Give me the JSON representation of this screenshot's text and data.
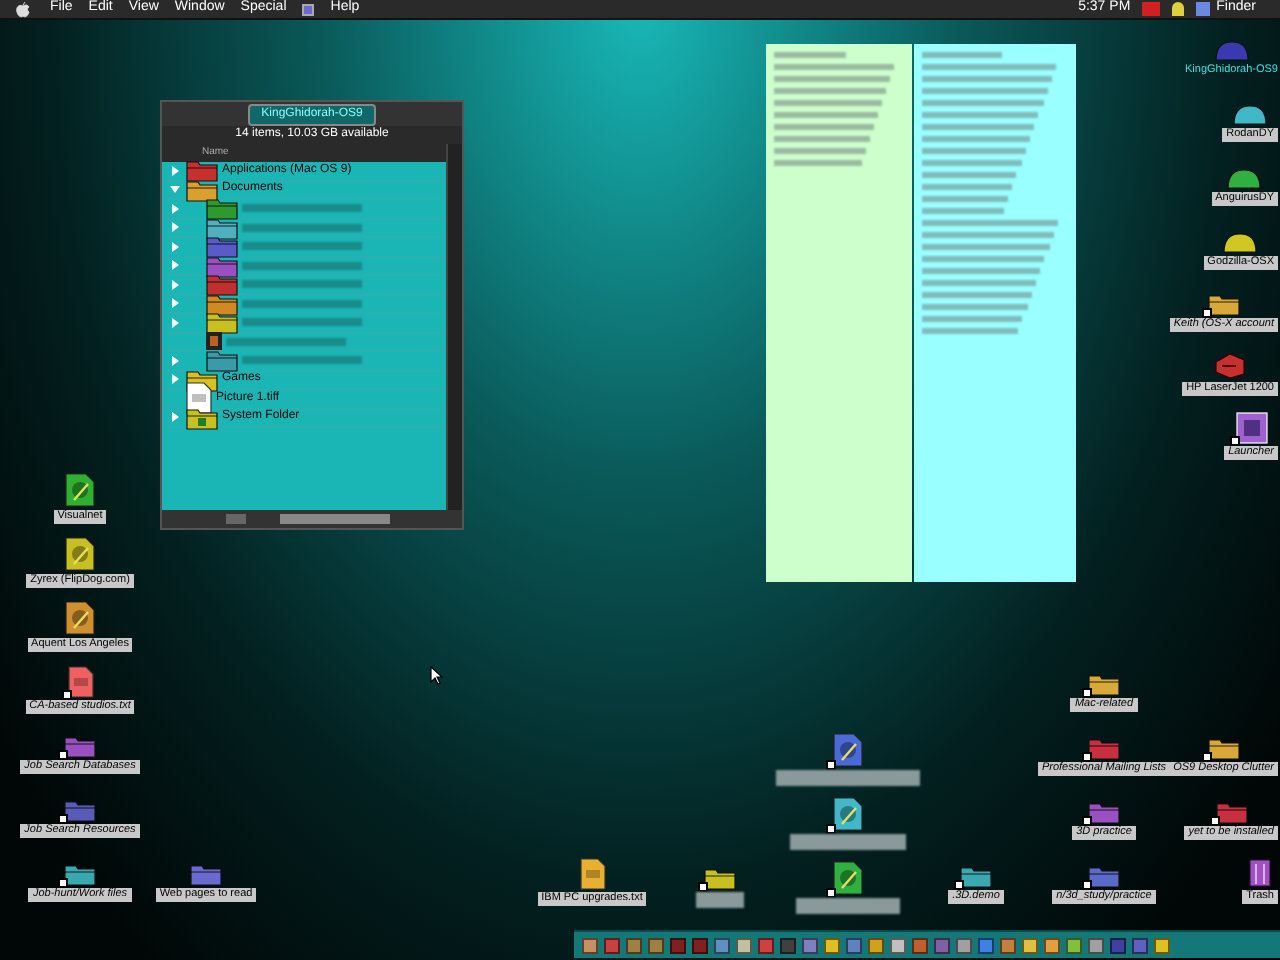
{
  "menu_bar": {
    "items": [
      "File",
      "Edit",
      "View",
      "Window",
      "Special",
      "Help"
    ],
    "clock": "5:37 PM",
    "app": "Finder"
  },
  "finder_window": {
    "title": "KingGhidorah-OS9",
    "info": "14 items, 10.03 GB available",
    "column": "Name",
    "rows": [
      {
        "name": "Applications (Mac OS 9)",
        "kind": "app-folder",
        "expanded": false
      },
      {
        "name": "Documents",
        "kind": "folder",
        "color": "#d9a030",
        "expanded": true,
        "children": [
          {
            "kind": "folder",
            "color": "#2e9a2e",
            "expanded": false
          },
          {
            "kind": "folder",
            "color": "#4fb0c0",
            "expanded": false
          },
          {
            "kind": "folder",
            "color": "#5a5ac8",
            "expanded": false
          },
          {
            "kind": "folder",
            "color": "#9a50c0",
            "expanded": false
          },
          {
            "kind": "folder",
            "color": "#c03030",
            "expanded": false
          },
          {
            "kind": "folder",
            "color": "#d08a20",
            "expanded": false
          },
          {
            "kind": "folder",
            "color": "#c8c020",
            "expanded": false
          },
          {
            "kind": "image"
          },
          {
            "kind": "folder",
            "color": "#3a9aa8",
            "expanded": false
          }
        ]
      },
      {
        "name": "Games",
        "kind": "folder",
        "color": "#d8c020",
        "expanded": false
      },
      {
        "name": "Picture 1.tiff",
        "kind": "document"
      },
      {
        "name": "System Folder",
        "kind": "system-folder",
        "expanded": false
      }
    ]
  },
  "stickies": [
    {
      "color": "#ccffcc"
    },
    {
      "color": "#99ffff"
    }
  ],
  "desktop_icons": [
    {
      "label": "KingGhidorah-OS9",
      "kind": "disk",
      "color": "#3a3ab0",
      "alias": false
    },
    {
      "label": "RodanDY",
      "kind": "disk",
      "color": "#40b8c8",
      "alias": false
    },
    {
      "label": "AnguirusDY",
      "kind": "disk",
      "color": "#30b040",
      "alias": false
    },
    {
      "label": "Godzilla-OSX",
      "kind": "disk",
      "color": "#d0c820",
      "alias": false
    },
    {
      "label": "Keith (OS-X account",
      "kind": "folder",
      "color": "#d8a838",
      "alias": true
    },
    {
      "label": "HP LaserJet 1200",
      "kind": "printer",
      "color": "#c83030",
      "alias": false
    },
    {
      "label": "Launcher",
      "kind": "launcher",
      "color": "#a060d0",
      "alias": true
    },
    {
      "label": "Visualnet",
      "kind": "app",
      "color": "#30b030",
      "alias": false
    },
    {
      "label": "Zyrex (FlipDog.com)",
      "kind": "app",
      "color": "#c8c020",
      "alias": false
    },
    {
      "label": "Aquent Los Angeles",
      "kind": "app",
      "color": "#d09030",
      "alias": false
    },
    {
      "label": "CA-based studios.txt",
      "kind": "document",
      "color": "#f06060",
      "alias": true
    },
    {
      "label": "Mac-related",
      "kind": "folder",
      "color": "#d8a838",
      "alias": true
    },
    {
      "label": "Job Search Databases",
      "kind": "folder",
      "color": "#9a50c0",
      "alias": true
    },
    {
      "kind": "app",
      "color": "#4a6ad8",
      "alias": true
    },
    {
      "label": "Professional Mailing Lists",
      "kind": "folder",
      "color": "#c83040",
      "alias": true
    },
    {
      "label": "OS9 Desktop Clutter",
      "kind": "folder",
      "color": "#d8a838",
      "alias": true
    },
    {
      "label": "Job Search Resources",
      "kind": "folder",
      "color": "#5a5ab8",
      "alias": true
    },
    {
      "kind": "app",
      "color": "#40b8c8",
      "alias": true
    },
    {
      "label": "3D practice",
      "kind": "folder",
      "color": "#9a50c0",
      "alias": true
    },
    {
      "label": "yet to be installed",
      "kind": "folder",
      "color": "#c83040",
      "alias": true
    },
    {
      "label": "Job-hunt/Work files",
      "kind": "folder",
      "color": "#3aa8b0",
      "alias": true
    },
    {
      "label": "Web pages to read",
      "kind": "folder",
      "color": "#6a6ad0",
      "alias": false
    },
    {
      "label": "IBM PC upgrades.txt",
      "kind": "document",
      "color": "#e8b030",
      "alias": false
    },
    {
      "kind": "folder",
      "color": "#c8c020",
      "alias": true
    },
    {
      "kind": "app",
      "color": "#30b040",
      "alias": true
    },
    {
      "label": ".3D.demo",
      "kind": "folder",
      "color": "#3aa8b0",
      "alias": true
    },
    {
      "label": "n/3d_study/practice",
      "kind": "folder",
      "color": "#5a6ac8",
      "alias": true
    },
    {
      "label": "Trash",
      "kind": "trash",
      "color": "#a050c0",
      "alias": false
    }
  ]
}
